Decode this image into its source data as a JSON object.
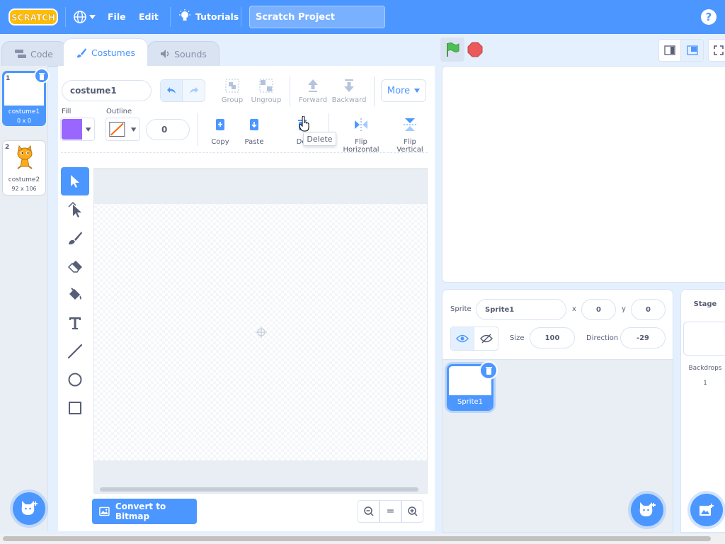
{
  "menu": {
    "logo": "SCRATCH",
    "file": "File",
    "edit": "Edit",
    "tutorials": "Tutorials",
    "project_title": "Scratch Project",
    "help": "?"
  },
  "tabs": {
    "code": "Code",
    "costumes": "Costumes",
    "sounds": "Sounds"
  },
  "costumes": [
    {
      "num": "1",
      "name": "costume1",
      "size": "0 x 0"
    },
    {
      "num": "2",
      "name": "costume2",
      "size": "92 x 106"
    }
  ],
  "editor": {
    "costume_name": "costume1",
    "group": "Group",
    "ungroup": "Ungroup",
    "forward": "Forward",
    "backward": "Backward",
    "more": "More",
    "fill_label": "Fill",
    "outline_label": "Outline",
    "outline_width": "0",
    "copy": "Copy",
    "paste": "Paste",
    "delete_partial": "Del",
    "delete_tooltip": "Delete",
    "flip_h": "Flip Horizontal",
    "flip_v": "Flip Vertical",
    "convert": "Convert to Bitmap",
    "zoom_reset": "="
  },
  "sprite_info": {
    "sprite_label": "Sprite",
    "sprite_name": "Sprite1",
    "x_label": "x",
    "x": "0",
    "y_label": "y",
    "y": "0",
    "size_label": "Size",
    "size": "100",
    "direction_label": "Direction",
    "direction": "-29"
  },
  "sprites": [
    {
      "name": "Sprite1"
    }
  ],
  "stage_pane": {
    "title": "Stage",
    "backdrops_label": "Backdrops",
    "backdrops_count": "1"
  },
  "colors": {
    "accent": "#4c97ff",
    "fill": "#9966ff",
    "green_flag": "#4cbf56",
    "stop": "#ec5959"
  }
}
